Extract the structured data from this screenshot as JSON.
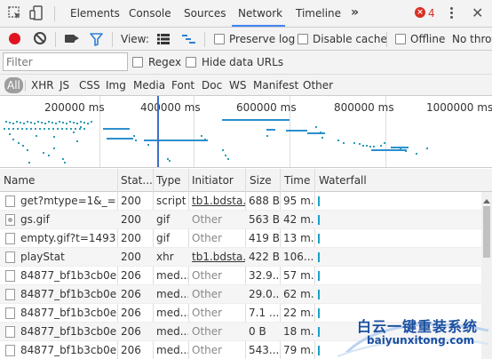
{
  "tabs": [
    "Elements",
    "Console",
    "Sources",
    "Network",
    "Timeline"
  ],
  "active_tab": "Network",
  "more_tabs": "»",
  "errors": {
    "count": "4",
    "badge": "×"
  },
  "toolbar": {
    "view_label": "View:",
    "preserve_log": "Preserve log",
    "disable_cache": "Disable cache",
    "offline": "Offline",
    "no_throttling": "No thrott"
  },
  "filter": {
    "placeholder": "Filter",
    "regex": "Regex",
    "hide_data_urls": "Hide data URLs"
  },
  "type_filters": [
    "All",
    "XHR",
    "JS",
    "CSS",
    "Img",
    "Media",
    "Font",
    "Doc",
    "WS",
    "Manifest",
    "Other"
  ],
  "overview": {
    "labels": [
      "200000 ms",
      "400000 ms",
      "600000 ms",
      "800000 ms",
      "1000000 ms"
    ]
  },
  "columns": [
    "Name",
    "Stat...",
    "Type",
    "Initiator",
    "Size",
    "Time",
    "Waterfall"
  ],
  "rows": [
    {
      "name": "get?mtype=1&_=...",
      "status": "200",
      "type": "script",
      "initiator": "tb1.bdsta...",
      "initiator_link": true,
      "size": "688 B",
      "time": "95 m...",
      "icon": "file"
    },
    {
      "name": "gs.gif",
      "status": "200",
      "type": "gif",
      "initiator": "Other",
      "initiator_link": false,
      "size": "563 B",
      "time": "42 m...",
      "icon": "image"
    },
    {
      "name": "empty.gif?t=1493...",
      "status": "200",
      "type": "gif",
      "initiator": "Other",
      "initiator_link": false,
      "size": "419 B",
      "time": "13 m...",
      "icon": "file"
    },
    {
      "name": "playStat",
      "status": "200",
      "type": "xhr",
      "initiator": "tb1.bdsta...",
      "initiator_link": true,
      "size": "422 B",
      "time": "106...",
      "icon": "file"
    },
    {
      "name": "84877_bf1b3cb0e...",
      "status": "206",
      "type": "med...",
      "initiator": "Other",
      "initiator_link": false,
      "size": "32.9...",
      "time": "57 m...",
      "icon": "file"
    },
    {
      "name": "84877_bf1b3cb0e...",
      "status": "206",
      "type": "med...",
      "initiator": "Other",
      "initiator_link": false,
      "size": "29.0...",
      "time": "62 m...",
      "icon": "file"
    },
    {
      "name": "84877_bf1b3cb0e...",
      "status": "206",
      "type": "med...",
      "initiator": "Other",
      "initiator_link": false,
      "size": "7.1 ...",
      "time": "22 m...",
      "icon": "file"
    },
    {
      "name": "84877_bf1b3cb0e...",
      "status": "206",
      "type": "med...",
      "initiator": "Other",
      "initiator_link": false,
      "size": "0 B",
      "time": "18 m...",
      "icon": "file"
    },
    {
      "name": "84877_bf1b3cb0e...",
      "status": "206",
      "type": "med...",
      "initiator": "Other",
      "initiator_link": false,
      "size": "543...",
      "time": "79 m...",
      "icon": "file"
    }
  ],
  "watermark": {
    "title": "白云一键重装系统",
    "url": "baiyunxitong.com"
  },
  "colors": {
    "accent": "#4285f4",
    "record": "#e0141e",
    "waterfall": "#1aa0c9",
    "error": "#d93025"
  }
}
